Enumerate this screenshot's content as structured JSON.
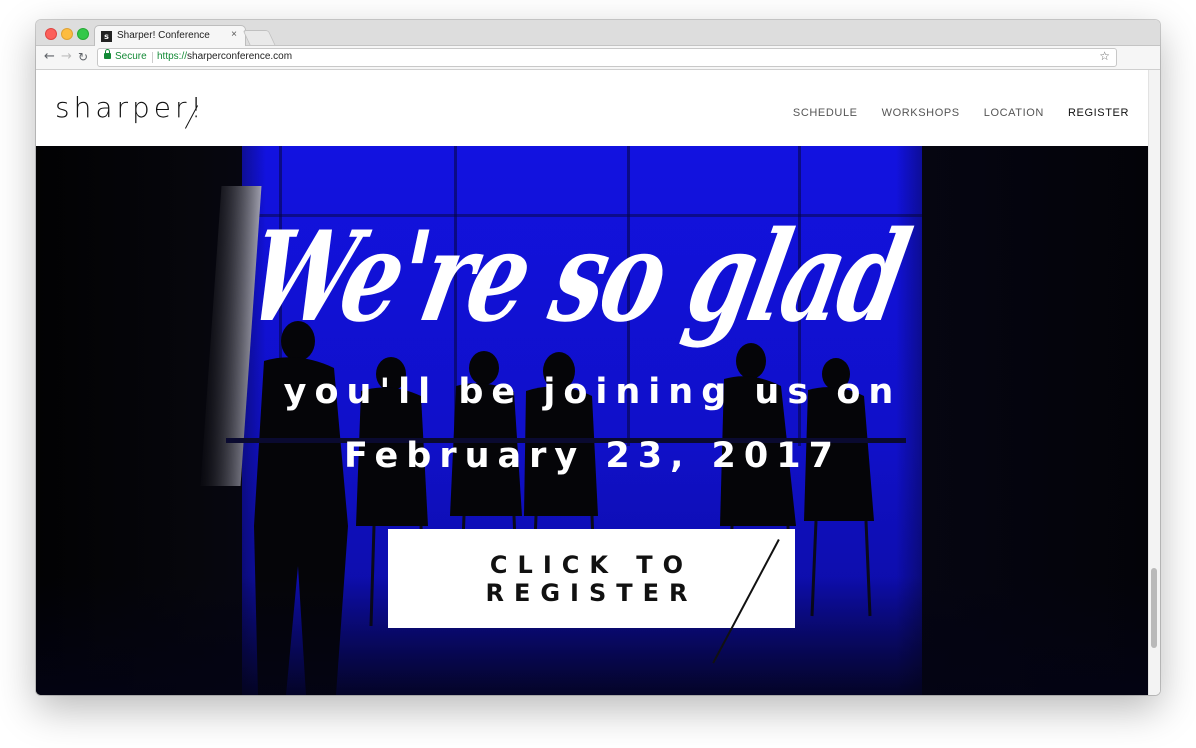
{
  "browser": {
    "tab_title": "Sharper! Conference",
    "tab_favicon": "s",
    "tab_close": "×",
    "secure_label": "Secure",
    "url_scheme": "https://",
    "url_host": "sharperconference.com",
    "nav_icons": [
      "back-arrow-icon",
      "forward-arrow-icon",
      "reload-icon",
      "bookmark-star-icon"
    ]
  },
  "site": {
    "logo": "sharper!",
    "nav": [
      {
        "label": "SCHEDULE"
      },
      {
        "label": "WORKSHOPS"
      },
      {
        "label": "LOCATION"
      },
      {
        "label": "REGISTER"
      }
    ]
  },
  "hero": {
    "headline": "We're so glad",
    "subline_1": "you'll be joining us on",
    "subline_2": "February 23, 2017",
    "cta_label": "CLICK TO REGISTER",
    "accent_color": "#1212e0"
  }
}
